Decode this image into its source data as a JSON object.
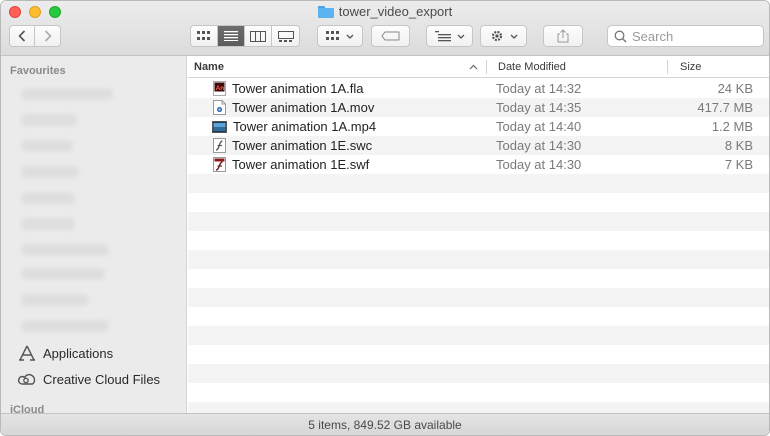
{
  "window": {
    "title": "tower_video_export"
  },
  "toolbar": {
    "search_placeholder": "Search"
  },
  "sidebar": {
    "favourites_header": "Favourites",
    "items": [
      {
        "label": "Applications",
        "icon": "applications-icon"
      },
      {
        "label": "Creative Cloud Files",
        "icon": "creative-cloud-icon"
      }
    ],
    "icloud_header": "iCloud"
  },
  "columns": {
    "name": "Name",
    "date_modified": "Date Modified",
    "size": "Size"
  },
  "files": [
    {
      "name": "Tower animation 1A.fla",
      "date": "Today at 14:32",
      "size": "24 KB",
      "icon": "animate-fla-icon"
    },
    {
      "name": "Tower animation 1A.mov",
      "date": "Today at 14:35",
      "size": "417.7 MB",
      "icon": "mov-file-icon"
    },
    {
      "name": "Tower animation 1A.mp4",
      "date": "Today at 14:40",
      "size": "1.2 MB",
      "icon": "mp4-file-icon"
    },
    {
      "name": "Tower animation 1E.swc",
      "date": "Today at 14:30",
      "size": "8 KB",
      "icon": "swc-file-icon"
    },
    {
      "name": "Tower animation 1E.swf",
      "date": "Today at 14:30",
      "size": "7 KB",
      "icon": "swf-file-icon"
    }
  ],
  "status": {
    "text": "5 items, 849.52 GB available"
  },
  "colors": {
    "accent": "#5cb3f0",
    "close": "#fe5f57",
    "minimize": "#febc2e",
    "maximize": "#28c840"
  }
}
